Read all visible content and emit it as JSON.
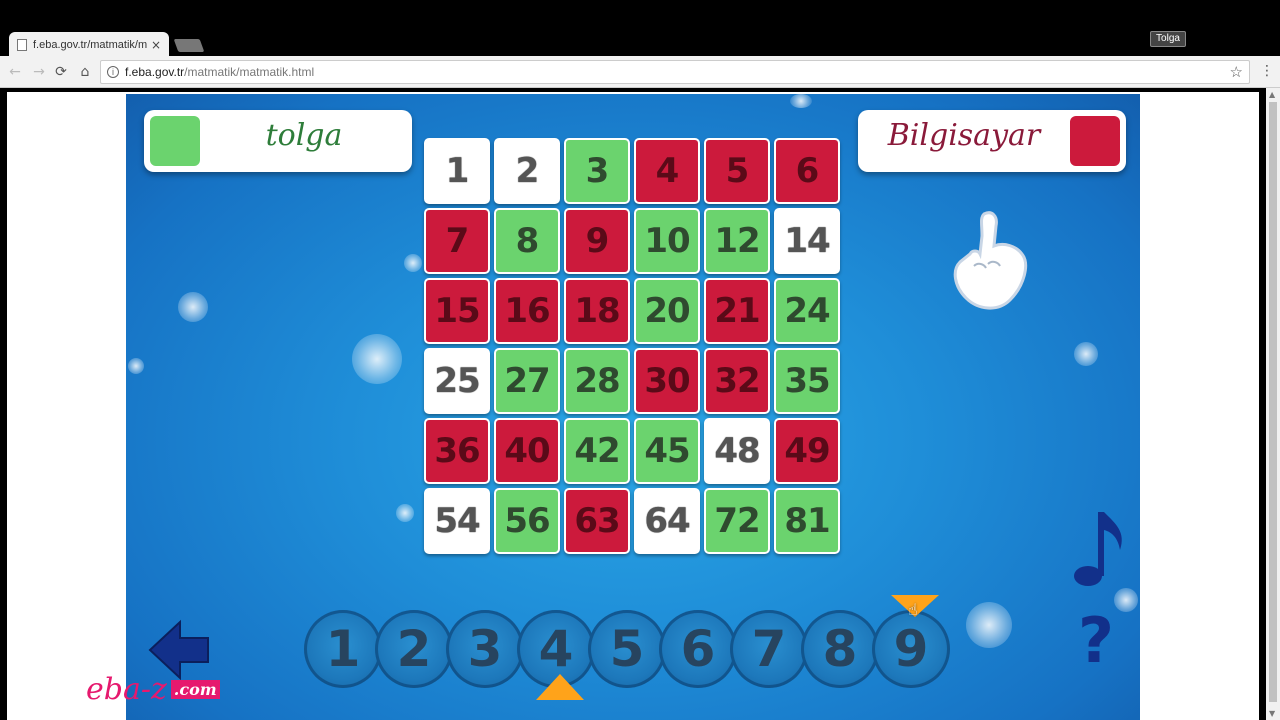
{
  "browser": {
    "tab_title": "f.eba.gov.tr/matmatik/ma",
    "tab_close": "×",
    "profile_name": "Tolga",
    "url_host": "f.eba.gov.tr",
    "url_path": "/matmatik/matmatik.html",
    "nav": {
      "back": "←",
      "forward": "→",
      "reload": "⟳",
      "home": "⌂",
      "star": "☆",
      "menu": "⋮",
      "info": "i"
    }
  },
  "game": {
    "player1": {
      "name": "tolga",
      "color": "#6bd36e"
    },
    "player2": {
      "name": "Bilgisayar",
      "color": "#cc1a3c"
    },
    "board": [
      {
        "value": "1",
        "owner": "white"
      },
      {
        "value": "2",
        "owner": "white"
      },
      {
        "value": "3",
        "owner": "green"
      },
      {
        "value": "4",
        "owner": "red"
      },
      {
        "value": "5",
        "owner": "red"
      },
      {
        "value": "6",
        "owner": "red"
      },
      {
        "value": "7",
        "owner": "red"
      },
      {
        "value": "8",
        "owner": "green"
      },
      {
        "value": "9",
        "owner": "red"
      },
      {
        "value": "10",
        "owner": "green"
      },
      {
        "value": "12",
        "owner": "green"
      },
      {
        "value": "14",
        "owner": "white"
      },
      {
        "value": "15",
        "owner": "red"
      },
      {
        "value": "16",
        "owner": "red"
      },
      {
        "value": "18",
        "owner": "red"
      },
      {
        "value": "20",
        "owner": "green"
      },
      {
        "value": "21",
        "owner": "red"
      },
      {
        "value": "24",
        "owner": "green"
      },
      {
        "value": "25",
        "owner": "white"
      },
      {
        "value": "27",
        "owner": "green"
      },
      {
        "value": "28",
        "owner": "green"
      },
      {
        "value": "30",
        "owner": "red"
      },
      {
        "value": "32",
        "owner": "red"
      },
      {
        "value": "35",
        "owner": "green"
      },
      {
        "value": "36",
        "owner": "red"
      },
      {
        "value": "40",
        "owner": "red"
      },
      {
        "value": "42",
        "owner": "green"
      },
      {
        "value": "45",
        "owner": "green"
      },
      {
        "value": "48",
        "owner": "white"
      },
      {
        "value": "49",
        "owner": "red"
      },
      {
        "value": "54",
        "owner": "white"
      },
      {
        "value": "56",
        "owner": "green"
      },
      {
        "value": "63",
        "owner": "red"
      },
      {
        "value": "64",
        "owner": "white"
      },
      {
        "value": "72",
        "owner": "green"
      },
      {
        "value": "81",
        "owner": "green"
      }
    ],
    "digits": [
      "1",
      "2",
      "3",
      "4",
      "5",
      "6",
      "7",
      "8",
      "9"
    ],
    "selected_bottom_digit": "4",
    "selected_top_digit": "9",
    "help_label": "?",
    "icons": {
      "hand": "pointing-hand-icon",
      "music": "music-note-icon",
      "back": "back-arrow-icon"
    },
    "watermark": {
      "text": "eba-z",
      "suffix": ".com"
    }
  }
}
